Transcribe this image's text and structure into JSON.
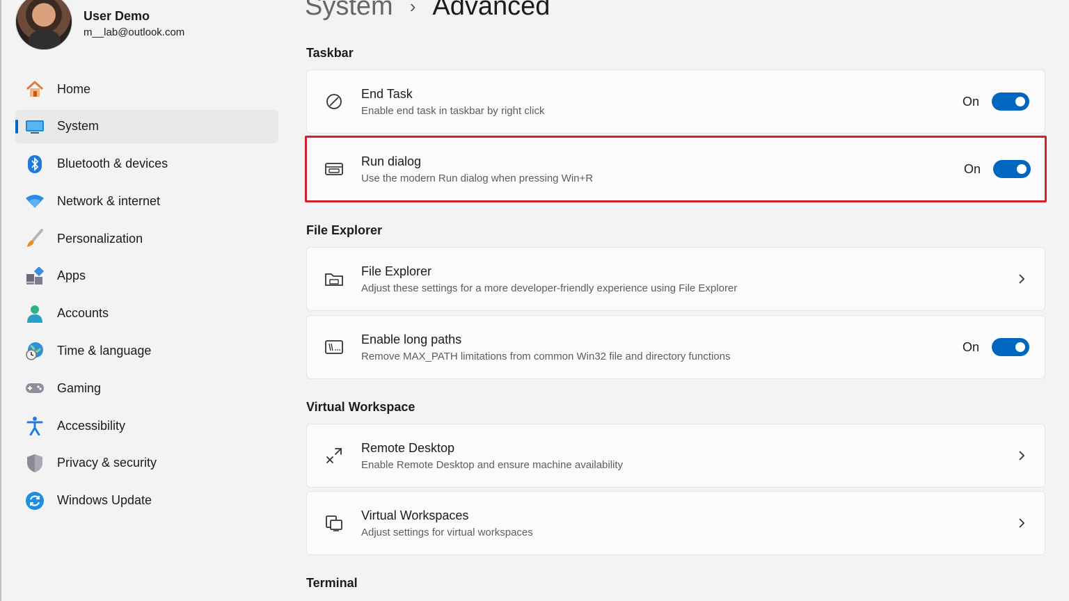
{
  "profile": {
    "name": "User Demo",
    "email": "m__lab@outlook.com"
  },
  "sidebar": {
    "items": [
      {
        "label": "Home",
        "icon": "home-icon"
      },
      {
        "label": "System",
        "icon": "system-icon",
        "active": true
      },
      {
        "label": "Bluetooth & devices",
        "icon": "bluetooth-icon"
      },
      {
        "label": "Network & internet",
        "icon": "wifi-icon"
      },
      {
        "label": "Personalization",
        "icon": "brush-icon"
      },
      {
        "label": "Apps",
        "icon": "apps-icon"
      },
      {
        "label": "Accounts",
        "icon": "accounts-icon"
      },
      {
        "label": "Time & language",
        "icon": "globe-clock-icon"
      },
      {
        "label": "Gaming",
        "icon": "gamepad-icon"
      },
      {
        "label": "Accessibility",
        "icon": "accessibility-icon"
      },
      {
        "label": "Privacy & security",
        "icon": "shield-icon"
      },
      {
        "label": "Windows Update",
        "icon": "update-icon"
      }
    ]
  },
  "breadcrumb": {
    "parent": "System",
    "separator": "›",
    "current": "Advanced"
  },
  "sections": {
    "taskbar": "Taskbar",
    "file_explorer": "File Explorer",
    "virtual_workspace": "Virtual Workspace",
    "terminal": "Terminal"
  },
  "cards": {
    "end_task": {
      "title": "End Task",
      "desc": "Enable end task in taskbar by right click",
      "state": "On",
      "icon": "end-task-icon"
    },
    "run_dialog": {
      "title": "Run dialog",
      "desc": "Use the modern Run dialog when pressing Win+R",
      "state": "On",
      "icon": "run-dialog-icon"
    },
    "file_explorer": {
      "title": "File Explorer",
      "desc": "Adjust these settings for a more developer-friendly experience using File Explorer",
      "icon": "folder-icon"
    },
    "long_paths": {
      "title": "Enable long paths",
      "desc": "Remove MAX_PATH limitations from common Win32 file and directory functions",
      "state": "On",
      "icon": "long-paths-icon"
    },
    "remote_desktop": {
      "title": "Remote Desktop",
      "desc": "Enable Remote Desktop and ensure machine availability",
      "icon": "remote-desktop-icon"
    },
    "virtual_workspaces": {
      "title": "Virtual Workspaces",
      "desc": "Adjust settings for virtual workspaces",
      "icon": "virtual-workspaces-icon"
    }
  },
  "colors": {
    "accent": "#0067c0",
    "highlight_border": "#d0212c",
    "background": "#f3f3f3",
    "card": "#fbfbfb"
  }
}
